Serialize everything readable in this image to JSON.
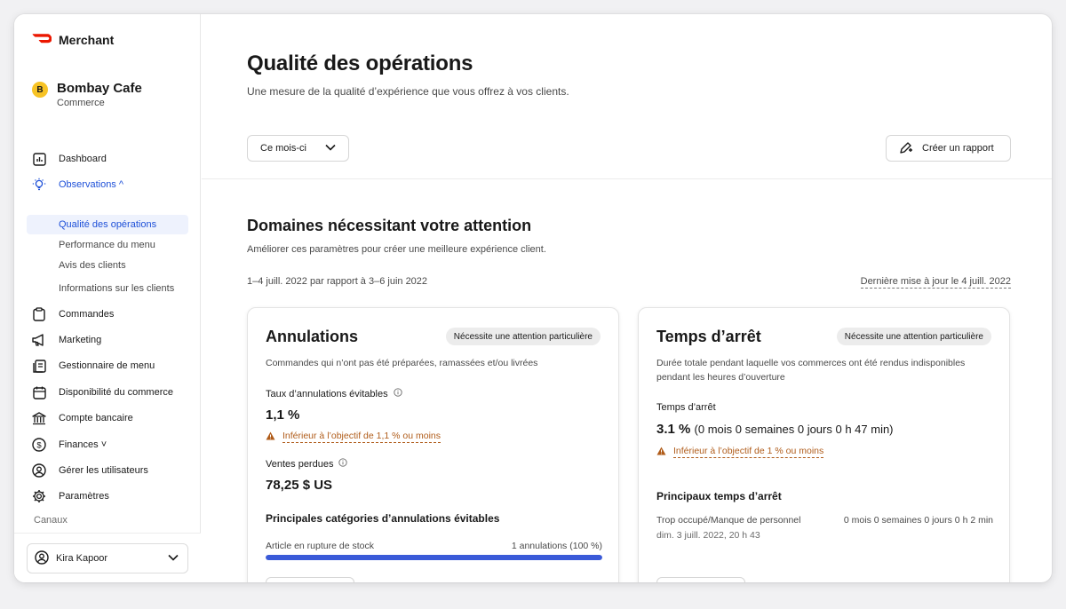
{
  "brand": {
    "name": "Merchant",
    "accent": "#eb1700"
  },
  "store": {
    "initial": "B",
    "name": "Bombay Cafe",
    "subtitle": "Commerce",
    "avatar_color": "#f7c325"
  },
  "nav": {
    "dashboard": "Dashboard",
    "observations": "Observations ^",
    "sub_items": {
      "qualite": "Qualité des opérations",
      "performance": "Performance du menu",
      "avis": "Avis des clients",
      "informations": "Informations sur les clients"
    },
    "commandes": "Commandes",
    "marketing": "Marketing",
    "gestionnaire": "Gestionnaire de menu",
    "disponibilite": "Disponibilité du commerce",
    "compte": "Compte bancaire",
    "finances": "Finances ˅",
    "utilisateurs": "Gérer les utilisateurs",
    "parametres": "Paramètres",
    "canaux": "Canaux",
    "active_color": "#1e50d8"
  },
  "user": {
    "name": "Kira Kapoor"
  },
  "header": {
    "title": "Qualité des opérations",
    "subtitle": "Une mesure de la qualité d’expérience que vous offrez à vos clients.",
    "period_selected": "Ce mois-ci",
    "report_button": "Créer un rapport"
  },
  "section": {
    "title": "Domaines nécessitant votre attention",
    "subtitle": "Améliorer ces paramètres pour créer une meilleure expérience client.",
    "date_range": "1–4 juill. 2022 par rapport à 3–6 juin 2022",
    "last_update": "Dernière mise à jour le 4 juill. 2022"
  },
  "cards": {
    "annulations": {
      "title": "Annulations",
      "badge": "Nécessite une attention particulière",
      "description": "Commandes qui n’ont pas été préparées, ramassées et/ou livrées",
      "metric1_label": "Taux d’annulations évitables",
      "metric1_value": "1,1 %",
      "metric1_warning": "Inférieur à l’objectif de 1,1 % ou moins",
      "metric2_label": "Ventes perdues",
      "metric2_value": "78,25 $ US",
      "categories_title": "Principales catégories d’annulations évitables",
      "category_label": "Article en rupture de stock",
      "category_value": "1 annulations (100 %)",
      "category_fraction": 1.0,
      "bar_color": "#3a5ad8"
    },
    "temps": {
      "title": "Temps d’arrêt",
      "badge": "Nécessite une attention particulière",
      "description": "Durée totale pendant laquelle vos commerces ont été rendus indisponibles pendant les heures d’ouverture",
      "metric_label": "Temps d’arrêt",
      "metric_value": "3.1 %",
      "metric_detail": "(0 mois 0 semaines 0 jours 0 h 47 min)",
      "metric_warning": "Inférieur à l’objectif de 1 % ou moins",
      "top_title": "Principaux temps d’arrêt",
      "top_reason": "Trop occupé/Manque de personnel",
      "top_duration": "0 mois 0 semaines 0 jours 0 h 2 min",
      "top_date": "dim. 3 juill. 2022, 20 h 43"
    }
  },
  "warning_color": "#b05c1a"
}
